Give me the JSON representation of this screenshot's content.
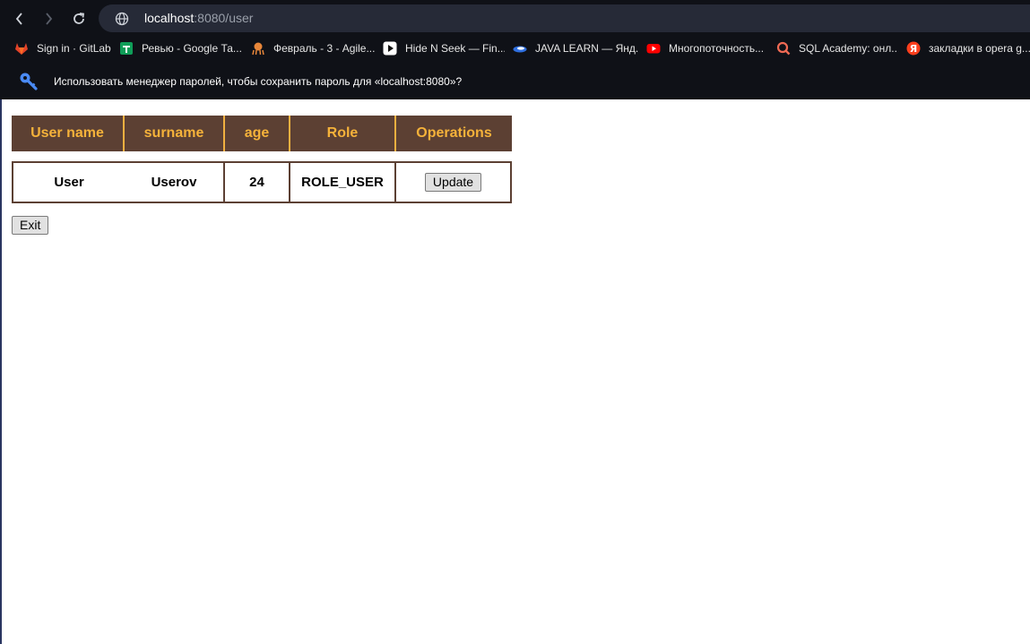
{
  "browser": {
    "url_host": "localhost",
    "url_rest": ":8080/user",
    "bookmarks": [
      {
        "label": "Sign in · GitLab",
        "icon": "gitlab-icon"
      },
      {
        "label": "Ревью - Google Та...",
        "icon": "google-sheets-icon"
      },
      {
        "label": "Февраль - 3 - Agile...",
        "icon": "octopus-icon"
      },
      {
        "label": "Hide N Seek — Fin...",
        "icon": "play-icon"
      },
      {
        "label": "JAVA LEARN — Янд...",
        "icon": "java-icon"
      },
      {
        "label": "Многопоточность...",
        "icon": "youtube-icon"
      },
      {
        "label": "SQL Academy: онл...",
        "icon": "sql-academy-icon"
      },
      {
        "label": "закладки в opera g...",
        "icon": "yandex-icon"
      }
    ],
    "password_prompt": "Использовать менеджер паролей, чтобы сохранить пароль для «localhost:8080»?"
  },
  "table": {
    "headers": {
      "username": "User name",
      "surname": "surname",
      "age": "age",
      "role": "Role",
      "operations": "Operations"
    },
    "rows": [
      {
        "username": "User",
        "surname": "Userov",
        "age": "24",
        "role": "ROLE_USER",
        "action": "Update"
      }
    ]
  },
  "exit_label": "Exit",
  "colors": {
    "header_bg": "#5c4033",
    "header_text": "#f5b23a",
    "chrome_bg": "#0f1117"
  }
}
